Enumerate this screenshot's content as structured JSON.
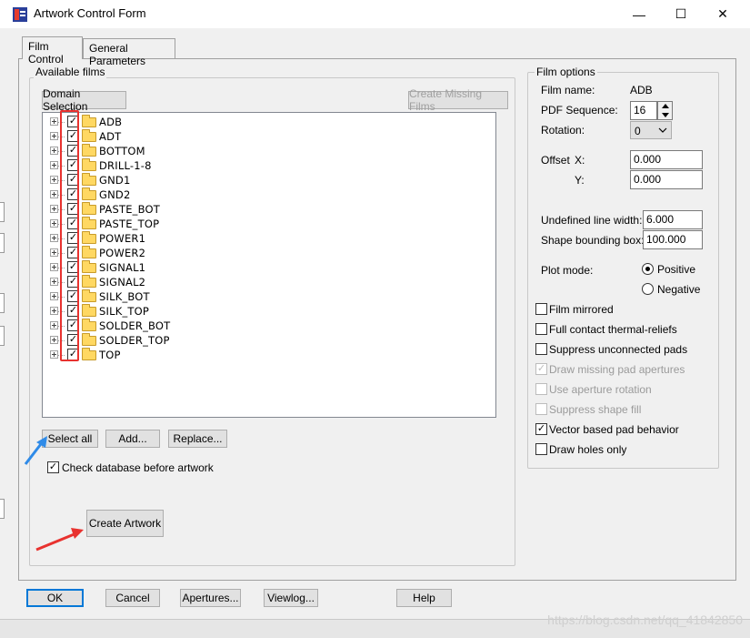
{
  "window": {
    "title": "Artwork Control Form",
    "controls": {
      "minimize": "—",
      "maximize": "☐",
      "close": "✕"
    }
  },
  "tabs": [
    {
      "label": "Film Control",
      "active": true
    },
    {
      "label": "General Parameters",
      "active": false
    }
  ],
  "available_films": {
    "group_title": "Available films",
    "domain_selection_label": "Domain Selection",
    "create_missing_label": "Create Missing Films",
    "films": [
      {
        "name": "ADB",
        "checked": true
      },
      {
        "name": "ADT",
        "checked": true
      },
      {
        "name": "BOTTOM",
        "checked": true
      },
      {
        "name": "DRILL-1-8",
        "checked": true
      },
      {
        "name": "GND1",
        "checked": true
      },
      {
        "name": "GND2",
        "checked": true
      },
      {
        "name": "PASTE_BOT",
        "checked": true
      },
      {
        "name": "PASTE_TOP",
        "checked": true
      },
      {
        "name": "POWER1",
        "checked": true
      },
      {
        "name": "POWER2",
        "checked": true
      },
      {
        "name": "SIGNAL1",
        "checked": true
      },
      {
        "name": "SIGNAL2",
        "checked": true
      },
      {
        "name": "SILK_BOT",
        "checked": true
      },
      {
        "name": "SILK_TOP",
        "checked": true
      },
      {
        "name": "SOLDER_BOT",
        "checked": true
      },
      {
        "name": "SOLDER_TOP",
        "checked": true
      },
      {
        "name": "TOP",
        "checked": true
      }
    ],
    "select_all_label": "Select all",
    "add_label": "Add...",
    "replace_label": "Replace...",
    "check_database_label": "Check database before artwork",
    "check_database_checked": true,
    "create_artwork_label": "Create Artwork"
  },
  "film_options": {
    "group_title": "Film options",
    "film_name_label": "Film name:",
    "film_name_value": "ADB",
    "pdf_sequence_label": "PDF Sequence:",
    "pdf_sequence_value": "16",
    "rotation_label": "Rotation:",
    "rotation_value": "0",
    "offset_label": "Offset",
    "offset_x_label": "X:",
    "offset_x_value": "0.000",
    "offset_y_label": "Y:",
    "offset_y_value": "0.000",
    "undefined_line_width_label": "Undefined line width:",
    "undefined_line_width_value": "6.000",
    "shape_bounding_box_label": "Shape bounding box:",
    "shape_bounding_box_value": "100.000",
    "plot_mode_label": "Plot mode:",
    "plot_mode_positive_label": "Positive",
    "plot_mode_negative_label": "Negative",
    "plot_mode_selected": "Positive",
    "checkboxes": [
      {
        "label": "Film mirrored",
        "checked": false,
        "enabled": true
      },
      {
        "label": "Full contact thermal-reliefs",
        "checked": false,
        "enabled": true
      },
      {
        "label": "Suppress unconnected pads",
        "checked": false,
        "enabled": true
      },
      {
        "label": "Draw missing pad apertures",
        "checked": true,
        "enabled": false
      },
      {
        "label": "Use aperture rotation",
        "checked": false,
        "enabled": false
      },
      {
        "label": "Suppress shape fill",
        "checked": false,
        "enabled": false
      },
      {
        "label": "Vector based pad behavior",
        "checked": true,
        "enabled": true
      },
      {
        "label": "Draw holes only",
        "checked": false,
        "enabled": true
      }
    ]
  },
  "footer": {
    "ok_label": "OK",
    "cancel_label": "Cancel",
    "apertures_label": "Apertures...",
    "viewlog_label": "Viewlog...",
    "help_label": "Help"
  },
  "watermark": "https://blog.csdn.net/qq_41842850",
  "colors": {
    "annotation_red": "#e8322f",
    "annotation_blue": "#2f8be8",
    "focus_blue": "#0078d7"
  }
}
